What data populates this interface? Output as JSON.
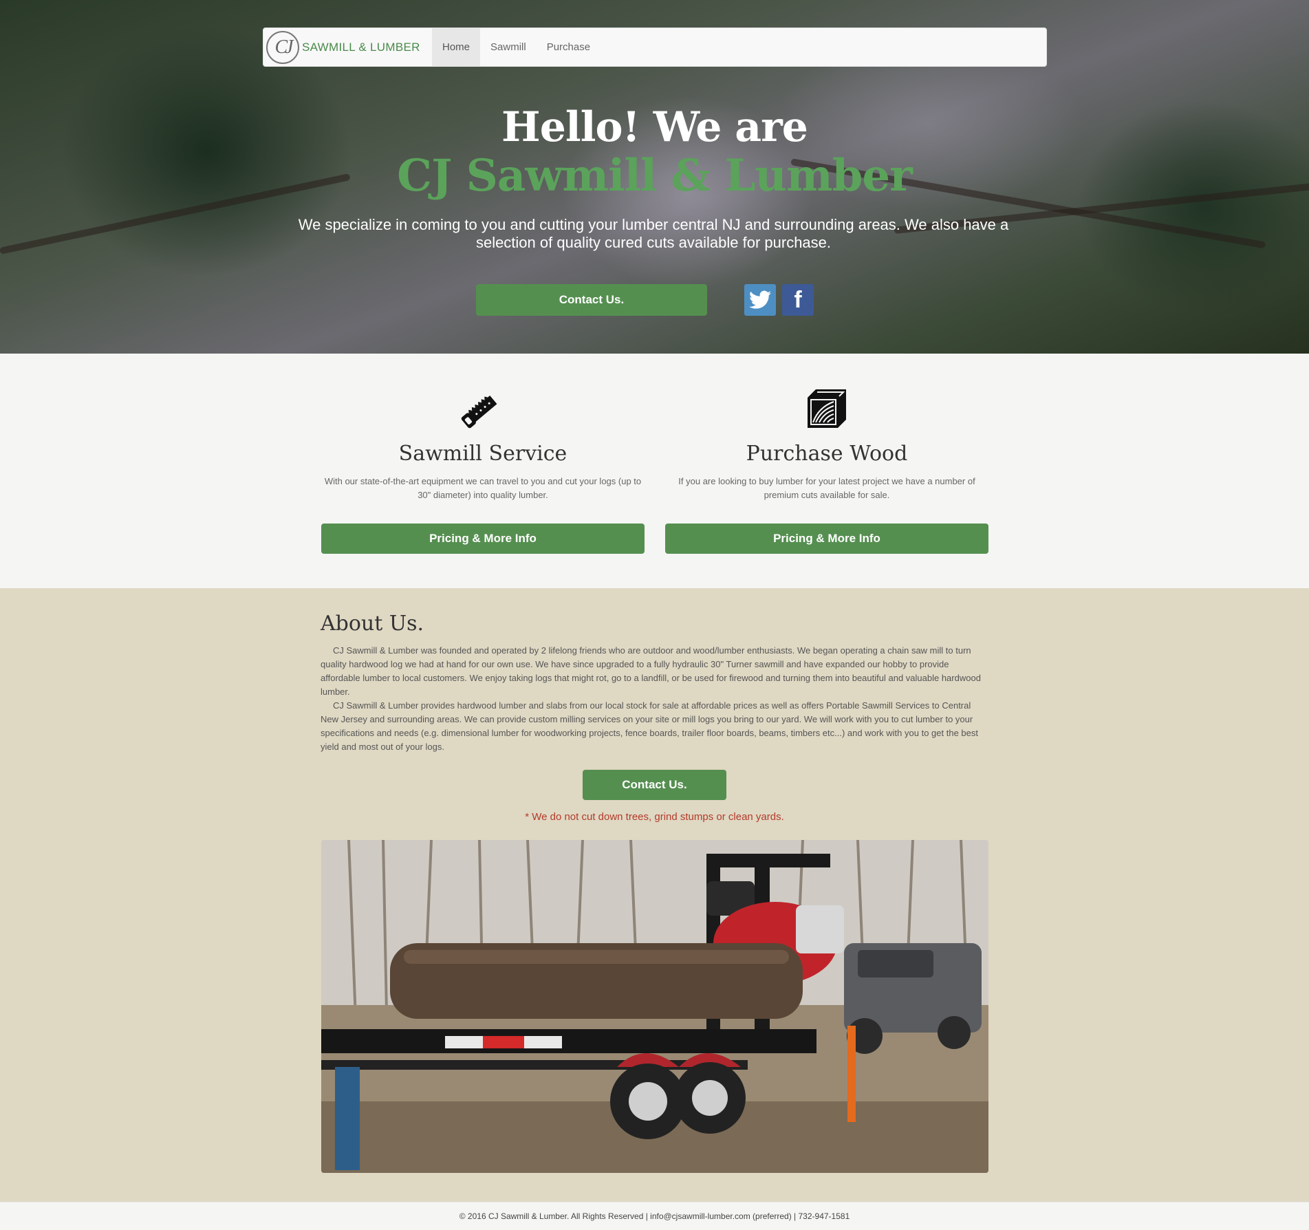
{
  "nav": {
    "brand_initials": "CJ",
    "brand_text": "SAWMILL & LUMBER",
    "items": [
      {
        "label": "Home",
        "active": true
      },
      {
        "label": "Sawmill",
        "active": false
      },
      {
        "label": "Purchase",
        "active": false
      }
    ]
  },
  "hero": {
    "title_line1": "Hello! We are",
    "title_line2": "CJ Sawmill & Lumber",
    "subtitle": "We specialize in coming to you and cutting your lumber central NJ and surrounding areas. We also have a selection of quality cured cuts available for purchase.",
    "contact_label": "Contact Us.",
    "social": [
      {
        "icon": "twitter-icon",
        "color": "#4e8fc3"
      },
      {
        "icon": "facebook-icon",
        "label": "f",
        "color": "#3d5a96"
      }
    ]
  },
  "services": [
    {
      "icon": "handsaw-icon",
      "title": "Sawmill Service",
      "description": "With our state-of-the-art equipment we can travel to you and cut your logs (up to 30\" diameter) into quality lumber.",
      "button_label": "Pricing & More Info"
    },
    {
      "icon": "wood-block-icon",
      "title": "Purchase Wood",
      "description": "If you are looking to buy lumber for your latest project we have a number of premium cuts available for sale.",
      "button_label": "Pricing & More Info"
    }
  ],
  "about": {
    "title": "About Us.",
    "paragraphs": [
      "CJ Sawmill & Lumber was founded and operated by 2 lifelong friends who are outdoor and wood/lumber enthusiasts. We began operating a chain saw mill to turn quality hardwood log we had at hand for our own use. We have since upgraded to a fully hydraulic 30\" Turner sawmill and have expanded our hobby to provide affordable lumber to local customers. We enjoy taking logs that might rot, go to a landfill, or be used for firewood and turning them into beautiful and valuable hardwood lumber.",
      "CJ Sawmill & Lumber provides hardwood lumber and slabs from our local stock for sale at affordable prices as well as offers Portable Sawmill Services to Central New Jersey and surrounding areas. We can provide custom milling services on your site or mill logs you bring to our yard. We will work with you to cut lumber to your specifications and needs (e.g. dimensional lumber for woodworking projects, fence boards, trailer floor boards, beams, timbers etc...) and work with you to get the best yield and most out of your logs."
    ],
    "contact_label": "Contact Us.",
    "note": "* We do not cut down trees, grind stumps or clean yards."
  },
  "footer": {
    "text": "© 2016 CJ Sawmill & Lumber. All Rights Reserved | info@cjsawmill-lumber.com (preferred) | 732-947-1581"
  },
  "colors": {
    "accent_green": "#558f50",
    "title_green": "#5ba35b",
    "about_bg": "#dfd8c3",
    "note_red": "#b33a2a"
  }
}
